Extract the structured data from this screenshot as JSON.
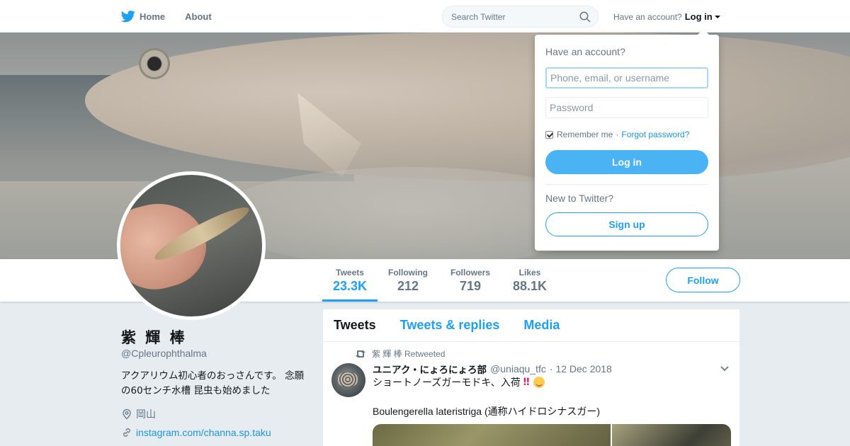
{
  "nav": {
    "home_label": "Home",
    "about_label": "About",
    "search_placeholder": "Search Twitter",
    "have_account": "Have an account?",
    "login_label": "Log in"
  },
  "profile": {
    "name": "紫 輝 棒",
    "handle": "@Cpleurophthalma",
    "bio": "アクアリウム初心者のおっさんです。 念願の60センチ水槽 昆虫も始めました",
    "location": "岡山",
    "link": "instagram.com/channa.sp.taku"
  },
  "stats": [
    {
      "label": "Tweets",
      "value": "23.3K"
    },
    {
      "label": "Following",
      "value": "212"
    },
    {
      "label": "Followers",
      "value": "719"
    },
    {
      "label": "Likes",
      "value": "88.1K"
    }
  ],
  "follow_label": "Follow",
  "timeline": {
    "tabs": [
      "Tweets",
      "Tweets & replies",
      "Media"
    ],
    "tweet": {
      "retweet_note": "紫 輝 棒 Retweeted",
      "author_name": "ユニアク・にょろにょろ部",
      "author_handle": "@uniaqu_tfc",
      "date": "· 12 Dec 2018",
      "text1": "ショートノーズガーモドキ、入荷",
      "text1_mark": "!!",
      "text2": "Boulengerella lateristriga (通称ハイドロシナスガー)"
    }
  },
  "login_dropdown": {
    "title": "Have an account?",
    "username_placeholder": "Phone, email, or username",
    "password_placeholder": "Password",
    "remember_label": "Remember me",
    "separator": "·",
    "forgot_label": "Forgot password?",
    "login_button": "Log in",
    "new_label": "New to Twitter?",
    "signup_button": "Sign up"
  },
  "colors": {
    "accent": "#1da1f2",
    "login_button_bg": "#4ab3f4",
    "text_secondary": "#657786"
  }
}
